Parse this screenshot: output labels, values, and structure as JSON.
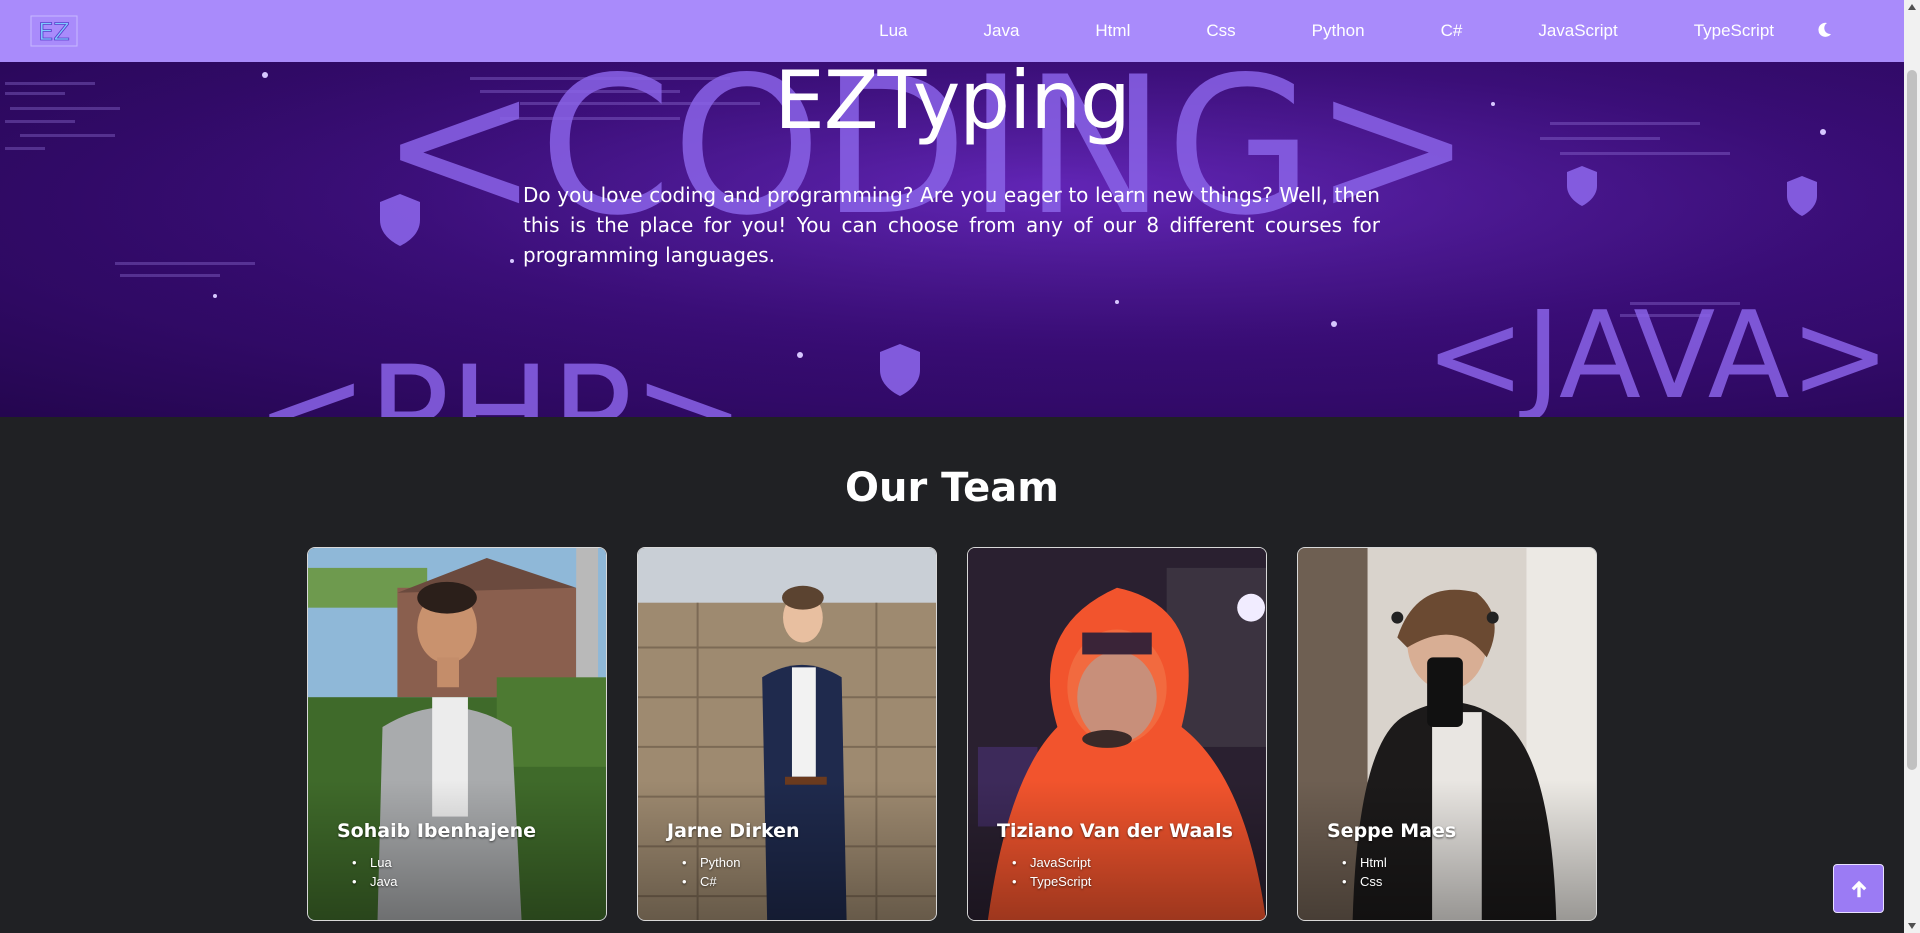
{
  "navbar": {
    "logo_text": "EZ",
    "links": [
      "Lua",
      "Java",
      "Html",
      "Css",
      "Python",
      "C#",
      "JavaScript",
      "TypeScript"
    ],
    "theme_icon": "moon-icon"
  },
  "hero": {
    "title": "EZTyping",
    "description": "Do you love coding and programming? Are you eager to learn new things? Well, then this is the place for you! You can choose from any of our 8 different courses for programming languages.",
    "background_words": [
      "<CODING>",
      "<PHP>",
      "<JAVA>"
    ]
  },
  "team": {
    "title": "Our Team",
    "members": [
      {
        "name": "Sohaib Ibenhajene",
        "languages": [
          "Lua",
          "Java"
        ]
      },
      {
        "name": "Jarne Dirken",
        "languages": [
          "Python",
          "C#"
        ]
      },
      {
        "name": "Tiziano Van der Waals",
        "languages": [
          "JavaScript",
          "TypeScript"
        ]
      },
      {
        "name": "Seppe Maes",
        "languages": [
          "Html",
          "Css"
        ]
      }
    ]
  },
  "back_to_top_icon": "arrow-up-icon",
  "colors": {
    "navbar": "#a98bfb",
    "hero": "#3b0d7a",
    "page_bg": "#202124",
    "accent": "#9b7bf4"
  }
}
